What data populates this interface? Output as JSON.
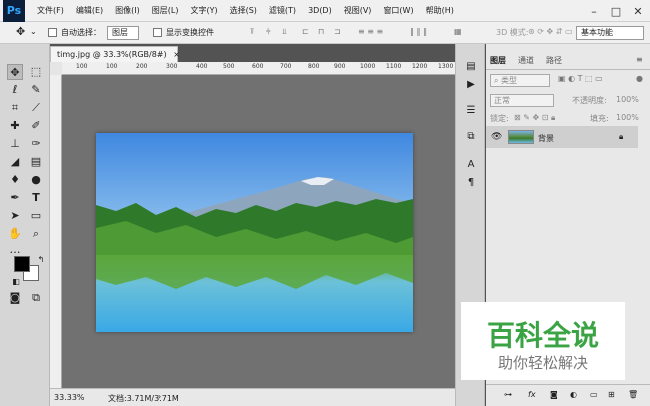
{
  "menubar": {
    "logo": "Ps",
    "items": [
      "文件(F)",
      "编辑(E)",
      "图像(I)",
      "图层(L)",
      "文字(Y)",
      "选择(S)",
      "滤镜(T)",
      "3D(D)",
      "视图(V)",
      "窗口(W)",
      "帮助(H)"
    ]
  },
  "options": {
    "auto_select_label": "自动选择：",
    "auto_select_value": "图层",
    "show_transform_label": "显示变换控件",
    "mode_3d_label": "3D 模式:",
    "workspace": "基本功能"
  },
  "document": {
    "tab_title": "timg.jpg @ 33.3%(RGB/8#)",
    "ruler_ticks": [
      "100",
      "100",
      "200",
      "300",
      "400",
      "500",
      "600",
      "700",
      "800",
      "900",
      "1000",
      "1100",
      "1200",
      "1300"
    ],
    "zoom": "33.33%",
    "doc_info": "文档:3.71M/3.71M"
  },
  "panel": {
    "tabs": [
      "图层",
      "通道",
      "路径"
    ],
    "kind_label": "类型",
    "blend_mode": "正常",
    "opacity_label": "不透明度:",
    "opacity_value": "100%",
    "lock_label": "锁定:",
    "fill_label": "填充:",
    "fill_value": "100%",
    "layer_name": "背景"
  },
  "watermark": {
    "title": "百科全说",
    "subtitle": "助你轻松解决"
  },
  "colors": {
    "accent": "#31a8ff",
    "foreground": "#000000",
    "background": "#ffffff",
    "watermark_green": "#3aa343"
  }
}
